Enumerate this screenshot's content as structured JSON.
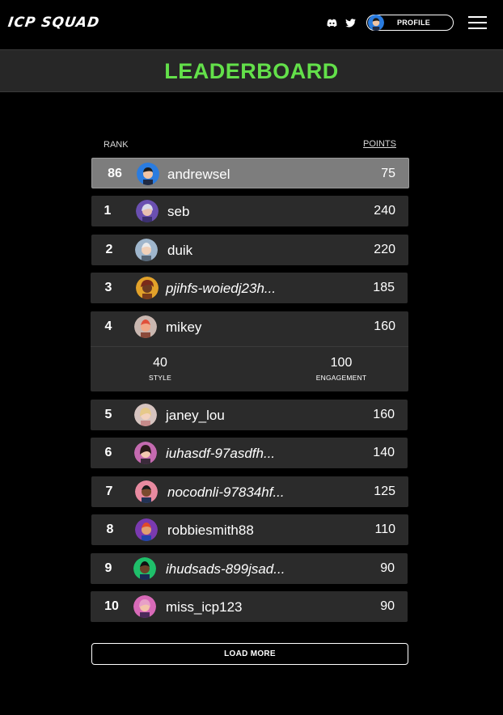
{
  "header": {
    "logo": "ICP SQUAD",
    "profile_label": "PROFILE"
  },
  "title": "LEADERBOARD",
  "columns": {
    "rank": "RANK",
    "points": "POINTS"
  },
  "current_user": {
    "rank": "86",
    "name": "andrewsel",
    "points": "75"
  },
  "rows": [
    {
      "rank": "1",
      "name": "seb",
      "points": "240"
    },
    {
      "rank": "2",
      "name": "duik",
      "points": "220"
    },
    {
      "rank": "3",
      "name": "pjihfs-woiedj23h...",
      "points": "185"
    },
    {
      "rank": "4",
      "name": "mikey",
      "points": "160"
    },
    {
      "rank": "5",
      "name": "janey_lou",
      "points": "160"
    },
    {
      "rank": "6",
      "name": "iuhasdf-97asdfh...",
      "points": "140"
    },
    {
      "rank": "7",
      "name": "nocodnli-97834hf...",
      "points": "125"
    },
    {
      "rank": "8",
      "name": "robbiesmith88",
      "points": "110"
    },
    {
      "rank": "9",
      "name": "ihudsads-899jsad...",
      "points": "90"
    },
    {
      "rank": "10",
      "name": "miss_icp123",
      "points": "90"
    }
  ],
  "expanded": {
    "style_value": "40",
    "style_label": "STYLE",
    "engagement_value": "100",
    "engagement_label": "ENGAGEMENT"
  },
  "load_more": "LOAD MORE",
  "colors": {
    "accent": "#63e04a",
    "row_bg": "#2b2b2b",
    "highlight_bg": "#7d7d7d"
  },
  "icons": [
    "discord-icon",
    "twitter-icon",
    "avatar",
    "menu-icon"
  ]
}
